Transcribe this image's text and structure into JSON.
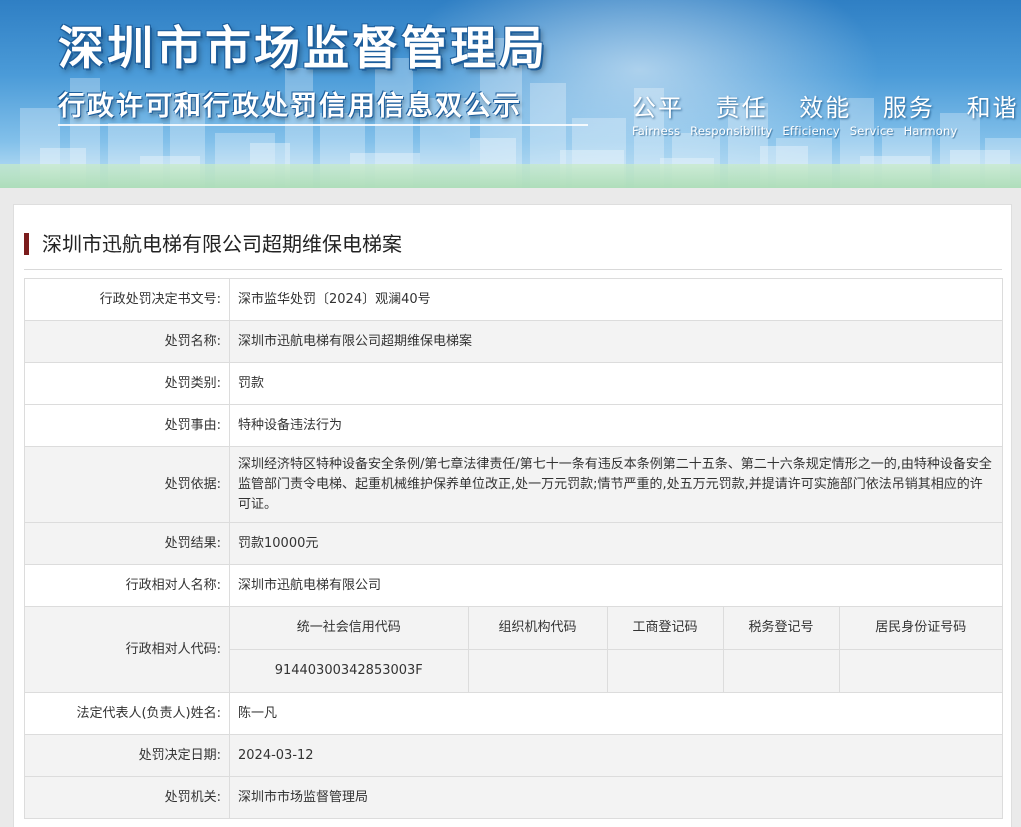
{
  "header": {
    "title": "深圳市市场监督管理局",
    "subtitle": "行政许可和行政处罚信用信息双公示",
    "slogan_cn": [
      "公平",
      "责任",
      "效能",
      "服务",
      "和谐"
    ],
    "slogan_en": [
      "Fairness",
      "Responsibility",
      "Efficiency",
      "Service",
      "Harmony"
    ]
  },
  "case": {
    "title": "深圳市迅航电梯有限公司超期维保电梯案",
    "rows": [
      {
        "label": "行政处罚决定书文号:",
        "value": "深市监华处罚〔2024〕观澜40号"
      },
      {
        "label": "处罚名称:",
        "value": "深圳市迅航电梯有限公司超期维保电梯案"
      },
      {
        "label": "处罚类别:",
        "value": "罚款"
      },
      {
        "label": "处罚事由:",
        "value": "特种设备违法行为"
      },
      {
        "label": "处罚依据:",
        "value": "深圳经济特区特种设备安全条例/第七章法律责任/第七十一条有违反本条例第二十五条、第二十六条规定情形之一的,由特种设备安全监管部门责令电梯、起重机械维护保养单位改正,处一万元罚款;情节严重的,处五万元罚款,并提请许可实施部门依法吊销其相应的许可证。"
      },
      {
        "label": "处罚结果:",
        "value": "罚款10000元"
      },
      {
        "label": "行政相对人名称:",
        "value": "深圳市迅航电梯有限公司"
      }
    ],
    "codes": {
      "label": "行政相对人代码:",
      "headers": [
        "统一社会信用代码",
        "组织机构代码",
        "工商登记码",
        "税务登记号",
        "居民身份证号码"
      ],
      "values": [
        "91440300342853003F",
        "",
        "",
        "",
        ""
      ]
    },
    "rows2": [
      {
        "label": "法定代表人(负责人)姓名:",
        "value": "陈一凡"
      },
      {
        "label": "处罚决定日期:",
        "value": "2024-03-12"
      },
      {
        "label": "处罚机关:",
        "value": "深圳市市场监督管理局"
      }
    ]
  }
}
